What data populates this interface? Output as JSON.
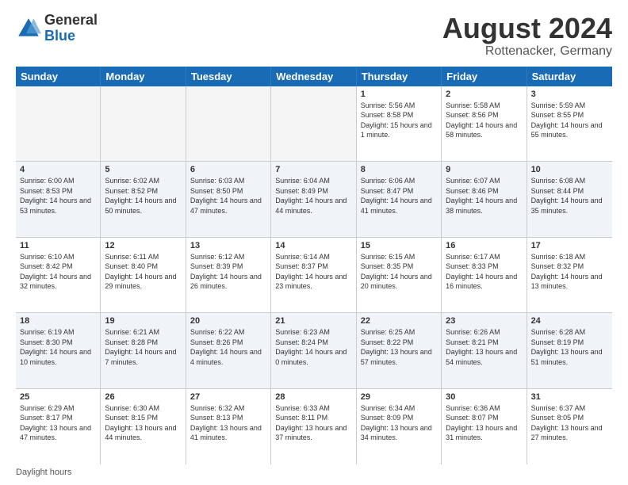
{
  "logo": {
    "general": "General",
    "blue": "Blue"
  },
  "title": "August 2024",
  "location": "Rottenacker, Germany",
  "days_of_week": [
    "Sunday",
    "Monday",
    "Tuesday",
    "Wednesday",
    "Thursday",
    "Friday",
    "Saturday"
  ],
  "footer": "Daylight hours",
  "weeks": [
    [
      {
        "day": "",
        "empty": true
      },
      {
        "day": "",
        "empty": true
      },
      {
        "day": "",
        "empty": true
      },
      {
        "day": "",
        "empty": true
      },
      {
        "day": "1",
        "sunrise": "5:56 AM",
        "sunset": "8:58 PM",
        "daylight": "15 hours and 1 minute."
      },
      {
        "day": "2",
        "sunrise": "5:58 AM",
        "sunset": "8:56 PM",
        "daylight": "14 hours and 58 minutes."
      },
      {
        "day": "3",
        "sunrise": "5:59 AM",
        "sunset": "8:55 PM",
        "daylight": "14 hours and 55 minutes."
      }
    ],
    [
      {
        "day": "4",
        "sunrise": "6:00 AM",
        "sunset": "8:53 PM",
        "daylight": "14 hours and 53 minutes."
      },
      {
        "day": "5",
        "sunrise": "6:02 AM",
        "sunset": "8:52 PM",
        "daylight": "14 hours and 50 minutes."
      },
      {
        "day": "6",
        "sunrise": "6:03 AM",
        "sunset": "8:50 PM",
        "daylight": "14 hours and 47 minutes."
      },
      {
        "day": "7",
        "sunrise": "6:04 AM",
        "sunset": "8:49 PM",
        "daylight": "14 hours and 44 minutes."
      },
      {
        "day": "8",
        "sunrise": "6:06 AM",
        "sunset": "8:47 PM",
        "daylight": "14 hours and 41 minutes."
      },
      {
        "day": "9",
        "sunrise": "6:07 AM",
        "sunset": "8:46 PM",
        "daylight": "14 hours and 38 minutes."
      },
      {
        "day": "10",
        "sunrise": "6:08 AM",
        "sunset": "8:44 PM",
        "daylight": "14 hours and 35 minutes."
      }
    ],
    [
      {
        "day": "11",
        "sunrise": "6:10 AM",
        "sunset": "8:42 PM",
        "daylight": "14 hours and 32 minutes."
      },
      {
        "day": "12",
        "sunrise": "6:11 AM",
        "sunset": "8:40 PM",
        "daylight": "14 hours and 29 minutes."
      },
      {
        "day": "13",
        "sunrise": "6:12 AM",
        "sunset": "8:39 PM",
        "daylight": "14 hours and 26 minutes."
      },
      {
        "day": "14",
        "sunrise": "6:14 AM",
        "sunset": "8:37 PM",
        "daylight": "14 hours and 23 minutes."
      },
      {
        "day": "15",
        "sunrise": "6:15 AM",
        "sunset": "8:35 PM",
        "daylight": "14 hours and 20 minutes."
      },
      {
        "day": "16",
        "sunrise": "6:17 AM",
        "sunset": "8:33 PM",
        "daylight": "14 hours and 16 minutes."
      },
      {
        "day": "17",
        "sunrise": "6:18 AM",
        "sunset": "8:32 PM",
        "daylight": "14 hours and 13 minutes."
      }
    ],
    [
      {
        "day": "18",
        "sunrise": "6:19 AM",
        "sunset": "8:30 PM",
        "daylight": "14 hours and 10 minutes."
      },
      {
        "day": "19",
        "sunrise": "6:21 AM",
        "sunset": "8:28 PM",
        "daylight": "14 hours and 7 minutes."
      },
      {
        "day": "20",
        "sunrise": "6:22 AM",
        "sunset": "8:26 PM",
        "daylight": "14 hours and 4 minutes."
      },
      {
        "day": "21",
        "sunrise": "6:23 AM",
        "sunset": "8:24 PM",
        "daylight": "14 hours and 0 minutes."
      },
      {
        "day": "22",
        "sunrise": "6:25 AM",
        "sunset": "8:22 PM",
        "daylight": "13 hours and 57 minutes."
      },
      {
        "day": "23",
        "sunrise": "6:26 AM",
        "sunset": "8:21 PM",
        "daylight": "13 hours and 54 minutes."
      },
      {
        "day": "24",
        "sunrise": "6:28 AM",
        "sunset": "8:19 PM",
        "daylight": "13 hours and 51 minutes."
      }
    ],
    [
      {
        "day": "25",
        "sunrise": "6:29 AM",
        "sunset": "8:17 PM",
        "daylight": "13 hours and 47 minutes."
      },
      {
        "day": "26",
        "sunrise": "6:30 AM",
        "sunset": "8:15 PM",
        "daylight": "13 hours and 44 minutes."
      },
      {
        "day": "27",
        "sunrise": "6:32 AM",
        "sunset": "8:13 PM",
        "daylight": "13 hours and 41 minutes."
      },
      {
        "day": "28",
        "sunrise": "6:33 AM",
        "sunset": "8:11 PM",
        "daylight": "13 hours and 37 minutes."
      },
      {
        "day": "29",
        "sunrise": "6:34 AM",
        "sunset": "8:09 PM",
        "daylight": "13 hours and 34 minutes."
      },
      {
        "day": "30",
        "sunrise": "6:36 AM",
        "sunset": "8:07 PM",
        "daylight": "13 hours and 31 minutes."
      },
      {
        "day": "31",
        "sunrise": "6:37 AM",
        "sunset": "8:05 PM",
        "daylight": "13 hours and 27 minutes."
      }
    ]
  ]
}
